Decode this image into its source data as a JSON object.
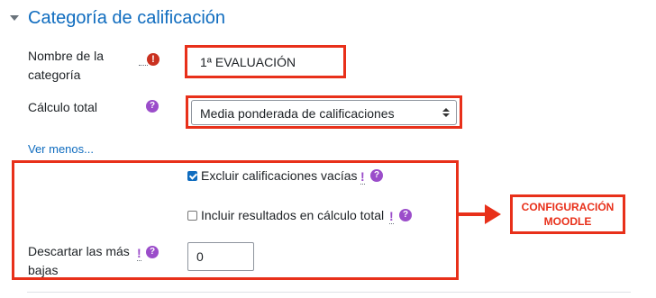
{
  "section": {
    "title": "Categoría de calificación"
  },
  "fields": {
    "category_name": {
      "label": "Nombre de la categoría",
      "value": "1ª EVALUACIÓN"
    },
    "aggregation": {
      "label": "Cálculo total",
      "value": "Media ponderada de calificaciones"
    },
    "show_less": "Ver menos...",
    "exclude_empty": {
      "label": "Excluir calificaciones vacías",
      "checked": true,
      "alert": "!"
    },
    "include_outcomes": {
      "label": "Incluir resultados en cálculo total",
      "checked": false,
      "alert": "!"
    },
    "drop_lowest": {
      "label": "Descartar las más bajas",
      "value": "0",
      "alert": "!"
    }
  },
  "icons": {
    "required": "!",
    "help": "?"
  },
  "annotation": {
    "text": "CONFIGURACIÓN MOODLE",
    "color": "#e8301a"
  },
  "colors": {
    "accent": "#0f6cbf",
    "help": "#9b4dca",
    "required": "#ca3120",
    "highlight": "#e8301a"
  }
}
